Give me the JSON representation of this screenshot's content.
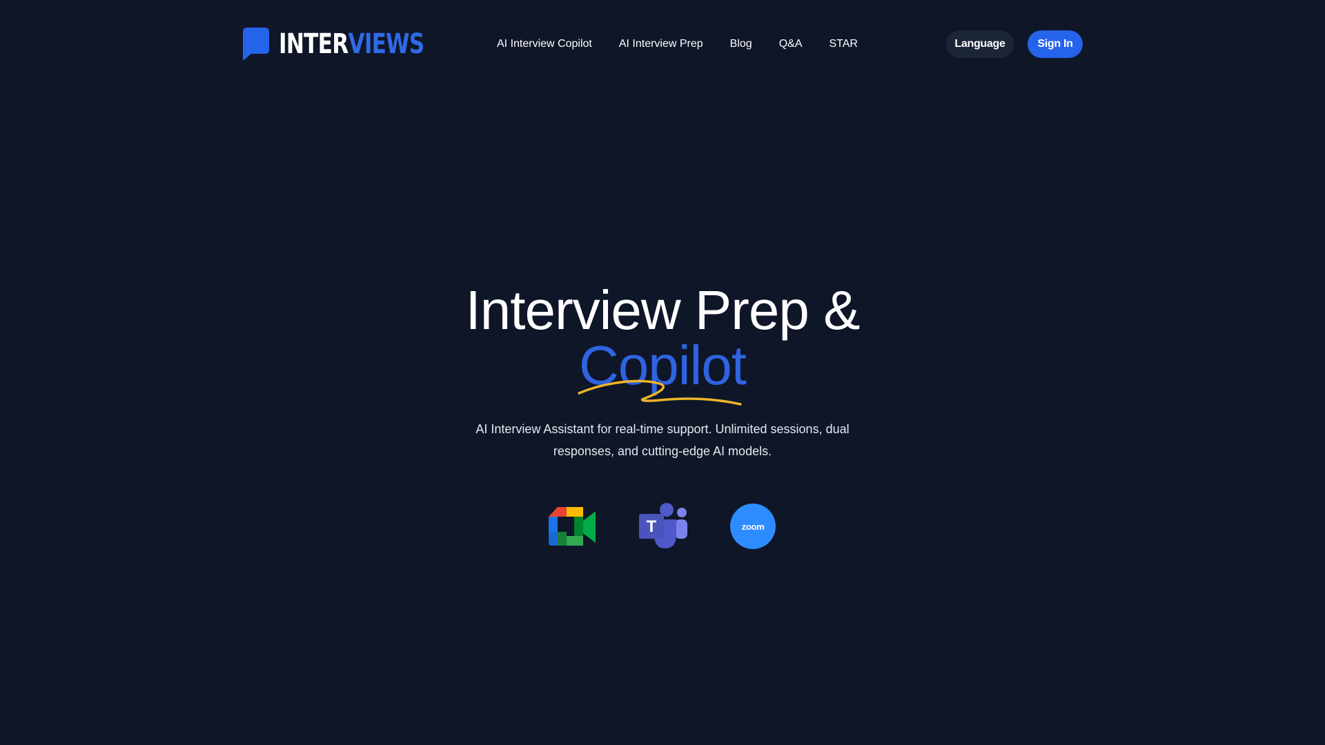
{
  "brand": {
    "name_part1": "INTER",
    "name_part2": "VIEWS",
    "colors": {
      "primary": "#2563eb",
      "background": "#0e1628",
      "accent_underline": "#f0b429"
    }
  },
  "nav": {
    "items": [
      {
        "label": "AI Interview Copilot"
      },
      {
        "label": "AI Interview Prep"
      },
      {
        "label": "Blog"
      },
      {
        "label": "Q&A"
      },
      {
        "label": "STAR"
      }
    ]
  },
  "header_actions": {
    "language_label": "Language",
    "signin_label": "Sign In"
  },
  "hero": {
    "title_line1": "Interview Prep &",
    "title_line2": "Copilot",
    "subtitle": "AI Interview Assistant for real-time support. Unlimited sessions, dual responses, and cutting-edge AI models."
  },
  "platforms": [
    {
      "icon": "google-meet-icon"
    },
    {
      "icon": "microsoft-teams-icon"
    },
    {
      "icon": "zoom-icon",
      "label": "zoom"
    }
  ]
}
